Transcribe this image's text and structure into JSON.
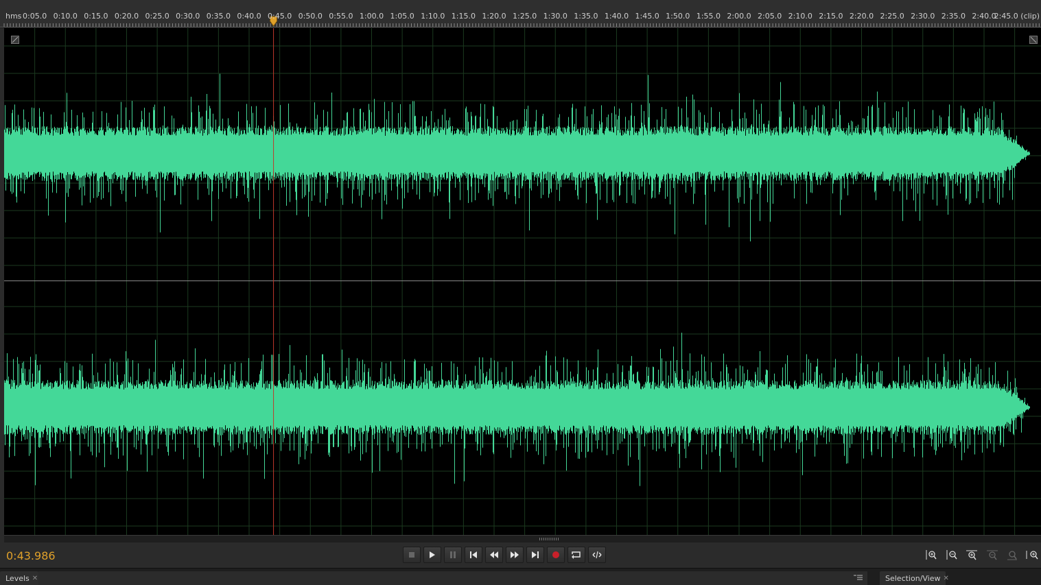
{
  "ruler": {
    "unit_label": "hms",
    "tick_labels": [
      "0:05.0",
      "0:10.0",
      "0:15.0",
      "0:20.0",
      "0:25.0",
      "0:30.0",
      "0:35.0",
      "0:40.0",
      "0:45.0",
      "0:50.0",
      "0:55.0",
      "1:00.0",
      "1:05.0",
      "1:10.0",
      "1:15.0",
      "1:20.0",
      "1:25.0",
      "1:30.0",
      "1:35.0",
      "1:40.0",
      "1:45.0",
      "1:50.0",
      "1:55.0",
      "2:00.0",
      "2:05.0",
      "2:10.0",
      "2:15.0",
      "2:20.0",
      "2:25.0",
      "2:30.0",
      "2:35.0",
      "2:40.0",
      "2:45.0 (clip)"
    ],
    "seconds_per_label": 5
  },
  "playhead": {
    "time_seconds": 43.986
  },
  "waveform": {
    "color": "#44d898",
    "channels": 2,
    "duration_seconds": 167.5
  },
  "timecode": {
    "value": "0:43.986",
    "color": "#e0a12a"
  },
  "transport": {
    "buttons": [
      "stop-icon",
      "play-icon",
      "pause-icon",
      "go-to-start-icon",
      "rewind-icon",
      "fast-forward-icon",
      "go-to-end-icon",
      "record-icon",
      "loop-icon",
      "skip-selection-icon"
    ]
  },
  "zoom": {
    "buttons": [
      "zoom-in-amplitude-icon",
      "zoom-out-amplitude-icon",
      "zoom-in-time-icon",
      "zoom-out-full-icon",
      "zoom-in-selection-icon",
      "zoom-selection-icon"
    ]
  },
  "panels": {
    "levels_tab": "Levels",
    "selection_tab": "Selection/View"
  }
}
